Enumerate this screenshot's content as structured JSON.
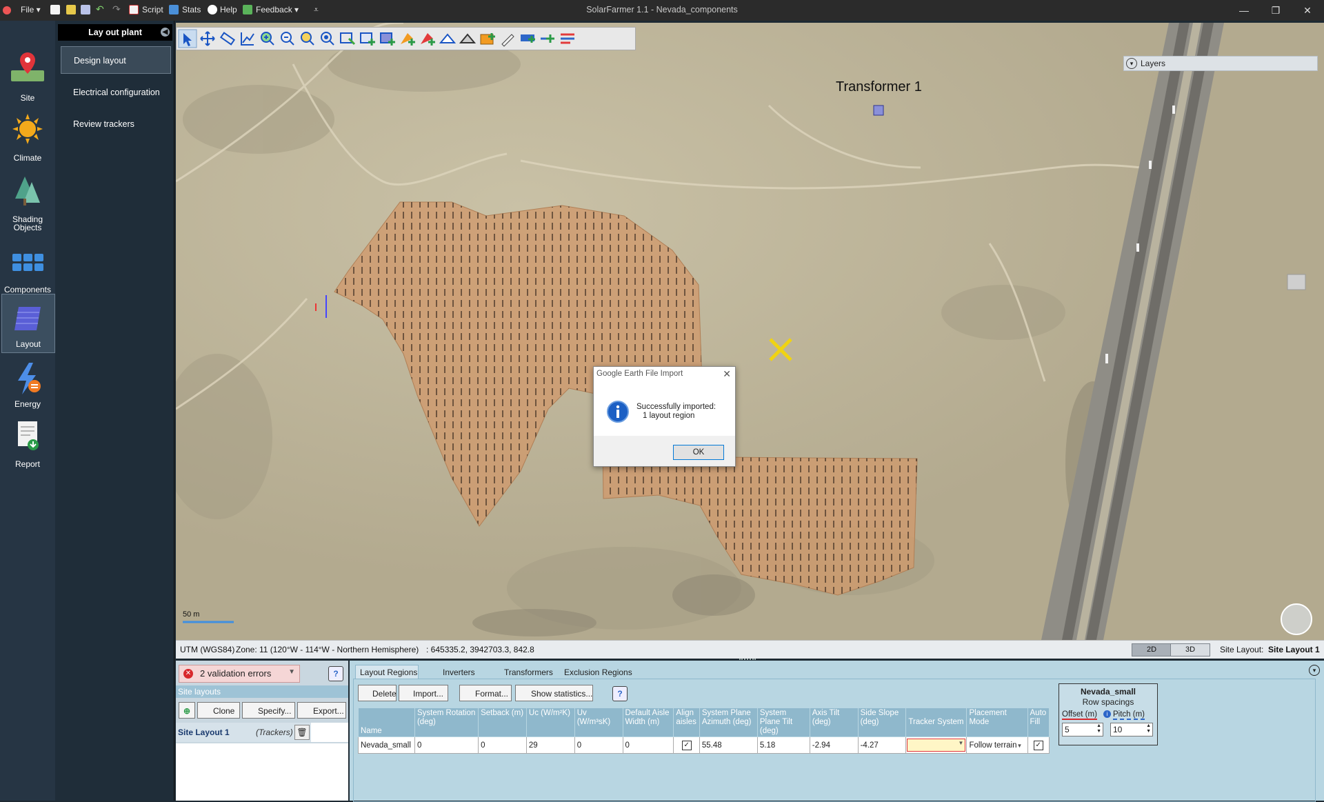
{
  "window": {
    "title": "SolarFarmer 1.1 - Nevada_components",
    "menu": {
      "file": "File",
      "script": "Script",
      "stats": "Stats",
      "help": "Help",
      "feedback": "Feedback"
    },
    "controls": {
      "minimize": "—",
      "restore": "❐",
      "close": "✕"
    }
  },
  "rail": {
    "items": [
      {
        "label": "Site",
        "icon": "map-pin-icon"
      },
      {
        "label": "Climate",
        "icon": "sun-icon"
      },
      {
        "label": "Shading\nObjects",
        "icon": "trees-icon"
      },
      {
        "label": "Components",
        "icon": "grid-icon"
      },
      {
        "label": "Layout",
        "icon": "panel-icon"
      },
      {
        "label": "Energy",
        "icon": "lightning-icon"
      },
      {
        "label": "Report",
        "icon": "report-icon"
      }
    ]
  },
  "subpanel": {
    "heading": "Lay out plant",
    "items": [
      "Design layout",
      "Electrical configuration",
      "Review trackers"
    ]
  },
  "map": {
    "layers_label": "Layers",
    "transformer_label": "Transformer 1",
    "scale_label": "50 m"
  },
  "statusbar": {
    "crs": "UTM (WGS84)",
    "zone": "Zone: 11 (120°W - 114°W - Northern Hemisphere)",
    "coords": ": 645335.2, 3942703.3, 842.8",
    "view_2d": "2D",
    "view_3d": "3D",
    "site_layout_label": "Site Layout:",
    "site_layout_value": "Site Layout 1"
  },
  "dialog": {
    "title": "Google Earth File Import",
    "message_line1": "Successfully imported:",
    "message_line2": "1 layout region",
    "ok": "OK"
  },
  "bottom_left": {
    "validation": "2 validation errors",
    "site_layouts_heading": "Site layouts",
    "clone": "Clone",
    "specify": "Specify...",
    "export": "Export...",
    "layout_name": "Site Layout 1",
    "layout_type": "(Trackers)"
  },
  "bottom_right": {
    "tabs": [
      "Layout Regions",
      "Inverters",
      "Transformers",
      "Exclusion Regions"
    ],
    "buttons": {
      "delete": "Delete",
      "import": "Import...",
      "format": "Format...",
      "stats": "Show statistics..."
    },
    "columns": [
      "Name",
      "System Rotation (deg)",
      "Setback (m)",
      "Uc (W/m²K)",
      "Uv (W/m³sK)",
      "Default Aisle Width (m)",
      "Align aisles",
      "System Plane Azimuth (deg)",
      "System Plane Tilt (deg)",
      "Axis Tilt (deg)",
      "Side Slope (deg)",
      "Tracker System",
      "Placement Mode",
      "Auto Fill"
    ],
    "row": {
      "name": "Nevada_small",
      "rotation": "0",
      "setback": "0",
      "uc": "29",
      "uv": "0",
      "aisle": "0",
      "align": "✓",
      "azimuth": "55.48",
      "tilt": "5.18",
      "axis_tilt": "-2.94",
      "side_slope": "-4.27",
      "tracker": "",
      "placement": "Follow terrain",
      "autofill": "✓"
    },
    "spacing": {
      "region": "Nevada_small",
      "subtitle": "Row spacings",
      "offset_label": "Offset (m)",
      "pitch_label": "Pitch (m)",
      "offset_value": "5",
      "pitch_value": "10"
    }
  }
}
